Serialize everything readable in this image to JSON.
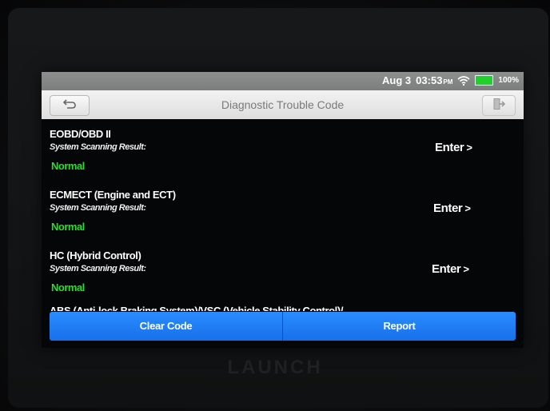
{
  "status_bar": {
    "date": "Aug 3",
    "time": "03:53",
    "ampm": "PM",
    "battery_percent": "100%",
    "battery_level": 1.0,
    "wifi_icon": "wifi-icon",
    "battery_color": "#22d02a"
  },
  "title_bar": {
    "back_icon": "back-arrow-icon",
    "title": "Diagnostic Trouble Code",
    "exit_icon": "exit-icon"
  },
  "systems": [
    {
      "name": "EOBD/OBD II",
      "label": "System Scanning Result:",
      "result": "Normal",
      "action": "Enter"
    },
    {
      "name": "ECMECT (Engine and ECT)",
      "label": "System Scanning Result:",
      "result": "Normal",
      "action": "Enter"
    },
    {
      "name": "HC (Hybrid Control)",
      "label": "System Scanning Result:",
      "result": "Normal",
      "action": "Enter"
    }
  ],
  "partial_system": {
    "name": "ABS (Anti-lock Braking System)/VSC (Vehicle Stability Control)/"
  },
  "bottom_buttons": {
    "clear_code": "Clear Code",
    "report": "Report"
  },
  "colors": {
    "result_normal": "#26e02c",
    "button_blue": "#1f7ef5"
  },
  "brand": "LAUNCH"
}
